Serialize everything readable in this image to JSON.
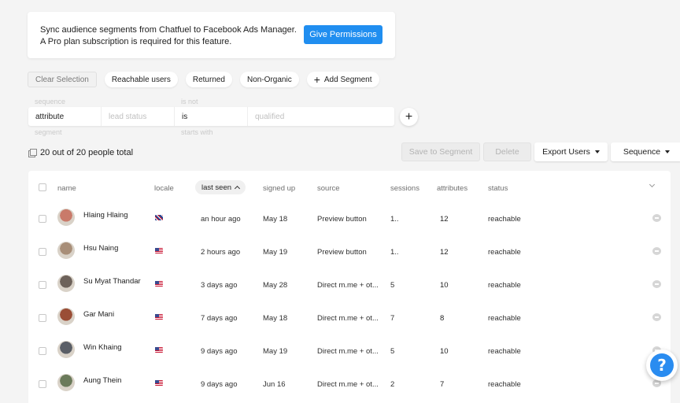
{
  "banner": {
    "line1": "Sync audience segments from Chatfuel to Facebook Ads Manager.",
    "line2": "A Pro plan subscription is required for this feature.",
    "button": "Give Permissions"
  },
  "chips": {
    "clear": "Clear Selection",
    "items": [
      "Reachable users",
      "Returned",
      "Non-Organic"
    ],
    "add_segment": "Add Segment"
  },
  "filter": {
    "above": [
      "sequence",
      "is not"
    ],
    "below": [
      "segment",
      "starts with"
    ],
    "cells": [
      "attribute",
      "lead status",
      "is",
      "qualified"
    ]
  },
  "summary": "20 out of 20 people total",
  "actions": {
    "save": "Save to Segment",
    "delete": "Delete",
    "export": "Export Users",
    "sequence": "Sequence"
  },
  "table": {
    "headers": {
      "name": "name",
      "locale": "locale",
      "last_seen": "last seen",
      "signed_up": "signed up",
      "source": "source",
      "sessions": "sessions",
      "attributes": "attributes",
      "status": "status"
    },
    "rows": [
      {
        "name": "Hlaing Hlaing",
        "locale": "gb",
        "last_seen": "an hour ago",
        "signed_up": "May 18",
        "source": "Preview button",
        "sessions": "1..",
        "attributes": "12",
        "status": "reachable",
        "avatar_color": "#c97a6a"
      },
      {
        "name": "Hsu Naing",
        "locale": "us",
        "last_seen": "2 hours ago",
        "signed_up": "May 19",
        "source": "Preview button",
        "sessions": "1..",
        "attributes": "12",
        "status": "reachable",
        "avatar_color": "#a88e78"
      },
      {
        "name": "Su Myat Thandar",
        "locale": "us",
        "last_seen": "3 days ago",
        "signed_up": "May 28",
        "source": "Direct m.me + ot...",
        "sessions": "5",
        "attributes": "10",
        "status": "reachable",
        "avatar_color": "#6d625a"
      },
      {
        "name": "Gar Mani",
        "locale": "us",
        "last_seen": "7 days ago",
        "signed_up": "May 18",
        "source": "Direct m.me + ot...",
        "sessions": "7",
        "attributes": "8",
        "status": "reachable",
        "avatar_color": "#9a4e36"
      },
      {
        "name": "Win Khaing",
        "locale": "us",
        "last_seen": "9 days ago",
        "signed_up": "May 19",
        "source": "Direct m.me + ot...",
        "sessions": "5",
        "attributes": "10",
        "status": "reachable",
        "avatar_color": "#5a5e66"
      },
      {
        "name": "Aung Thein",
        "locale": "us",
        "last_seen": "9 days ago",
        "signed_up": "Jun 16",
        "source": "Direct m.me + ot...",
        "sessions": "2",
        "attributes": "7",
        "status": "reachable",
        "avatar_color": "#6b7a5a"
      }
    ]
  },
  "help": "?"
}
